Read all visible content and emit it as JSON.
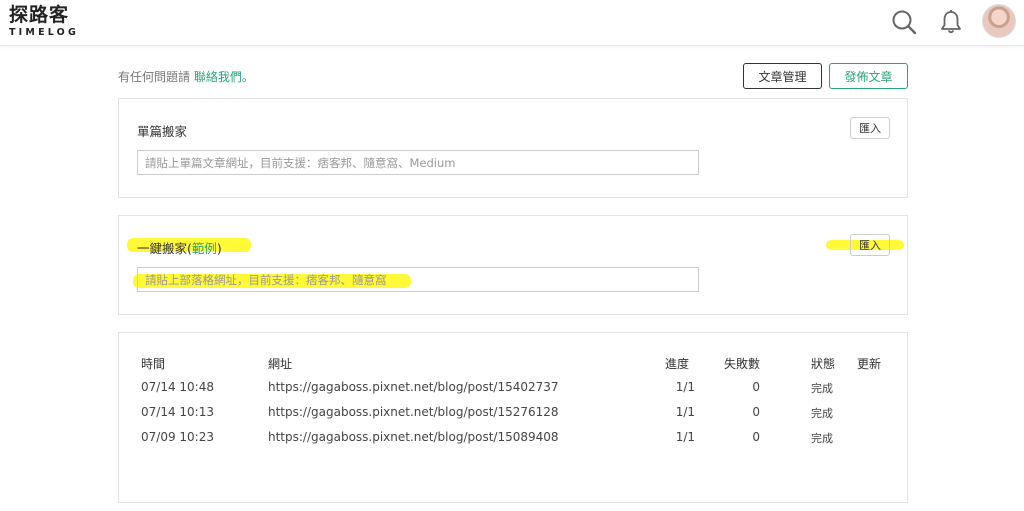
{
  "header": {
    "logo_main": "探路客",
    "logo_sub": "TIMELOG",
    "icons": [
      "search-icon",
      "bell-icon",
      "avatar"
    ]
  },
  "topbar": {
    "contact_prefix": "有任何問題請",
    "contact_link": "聯絡我們。",
    "manage_label": "文章管理",
    "publish_label": "發佈文章"
  },
  "single_move": {
    "title": "單篇搬家",
    "import_label": "匯入",
    "placeholder": "請貼上單篇文章網址，目前支援：痞客邦、隨意窩、Medium"
  },
  "bulk_move": {
    "title_prefix": "一鍵搬家(",
    "example_link": "範例",
    "title_suffix": ")",
    "import_label": "匯入",
    "placeholder": "請貼上部落格網址，目前支援：痞客邦、隨意窩"
  },
  "history": {
    "columns": {
      "time": "時間",
      "url": "網址",
      "progress": "進度",
      "failed": "失敗數",
      "status": "狀態",
      "update": "更新"
    },
    "rows": [
      {
        "time": "07/14 10:48",
        "url": "https://gagaboss.pixnet.net/blog/post/15402737",
        "progress": "1/1",
        "failed": "0",
        "status": "完成"
      },
      {
        "time": "07/14 10:13",
        "url": "https://gagaboss.pixnet.net/blog/post/15276128",
        "progress": "1/1",
        "failed": "0",
        "status": "完成"
      },
      {
        "time": "07/09 10:23",
        "url": "https://gagaboss.pixnet.net/blog/post/15089408",
        "progress": "1/1",
        "failed": "0",
        "status": "完成"
      }
    ]
  },
  "colors": {
    "accent": "#2aa37c",
    "highlight": "#fff700"
  }
}
